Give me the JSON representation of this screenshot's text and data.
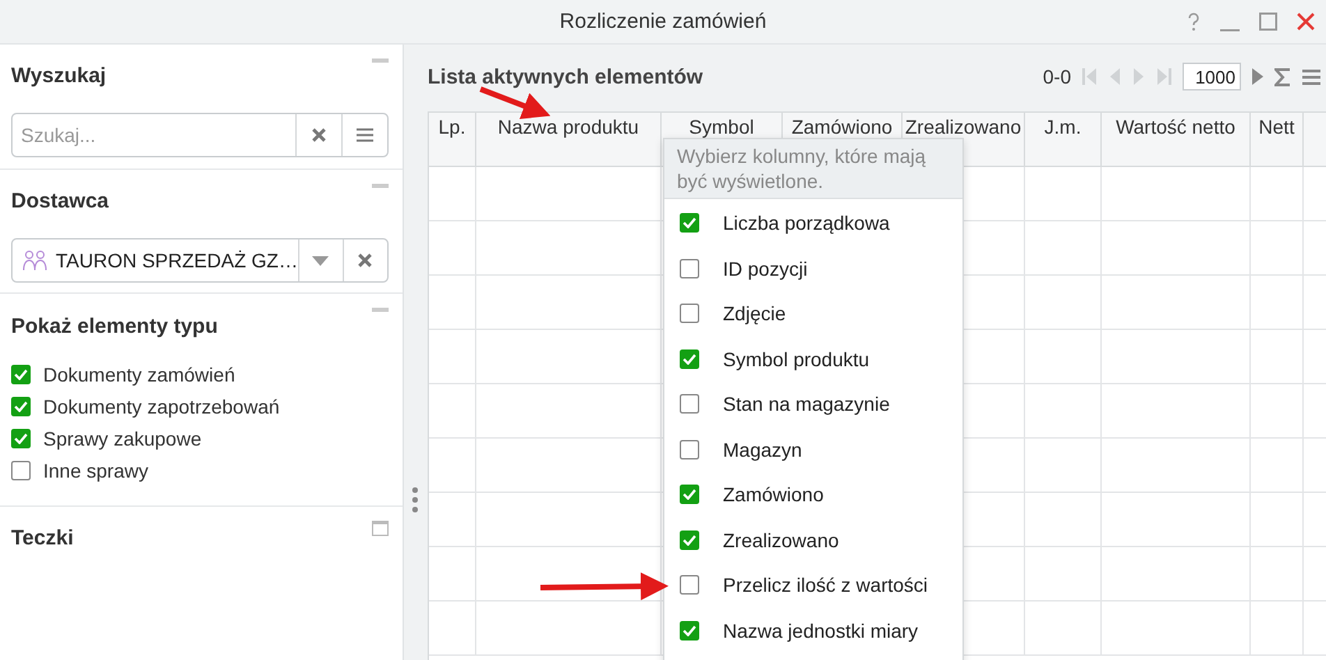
{
  "window": {
    "title": "Rozliczenie zamówień"
  },
  "search": {
    "title": "Wyszukaj",
    "placeholder": "Szukaj..."
  },
  "supplier": {
    "title": "Dostawca",
    "value": "TAURON SPRZEDAŻ GZ…"
  },
  "types": {
    "title": "Pokaż elementy typu",
    "items": [
      {
        "label": "Dokumenty zamówień",
        "checked": true
      },
      {
        "label": "Dokumenty zapotrzebowań",
        "checked": true
      },
      {
        "label": "Sprawy zakupowe",
        "checked": true
      },
      {
        "label": "Inne sprawy",
        "checked": false
      }
    ]
  },
  "folders": {
    "title": "Teczki"
  },
  "list": {
    "title": "Lista aktywnych elementów",
    "range": "0-0",
    "page_size": "1000",
    "columns": [
      "Lp.",
      "Nazwa produktu",
      "Symbol",
      "Zamówiono",
      "Zrealizowano",
      "J.m.",
      "Wartość netto",
      "Nett"
    ],
    "column_picker": {
      "hint": "Wybierz kolumny, które mają być wyświetlone.",
      "items": [
        {
          "label": "Liczba porządkowa",
          "checked": true
        },
        {
          "label": "ID pozycji",
          "checked": false
        },
        {
          "label": "Zdjęcie",
          "checked": false
        },
        {
          "label": "Symbol produktu",
          "checked": true
        },
        {
          "label": "Stan na magazynie",
          "checked": false
        },
        {
          "label": "Magazyn",
          "checked": false
        },
        {
          "label": "Zamówiono",
          "checked": true
        },
        {
          "label": "Zrealizowano",
          "checked": true
        },
        {
          "label": "Przelicz ilość z wartości",
          "checked": false
        },
        {
          "label": "Nazwa jednostki miary",
          "checked": true
        }
      ]
    }
  }
}
